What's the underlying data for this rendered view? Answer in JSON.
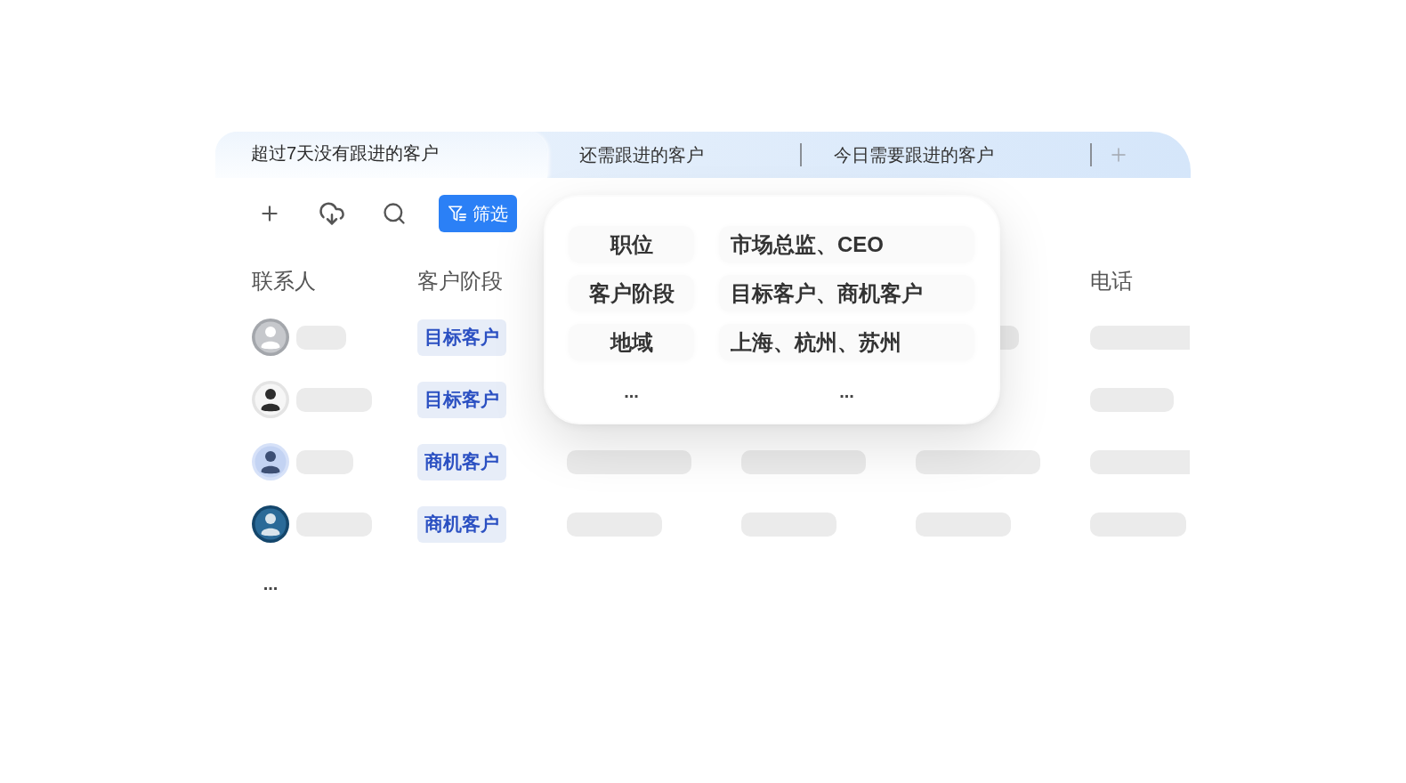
{
  "tabs": [
    {
      "label": "超过7天没有跟进的客户",
      "selected": true
    },
    {
      "label": "还需跟进的客户",
      "selected": false
    },
    {
      "label": "今日需要跟进的客户",
      "selected": false
    }
  ],
  "toolbar": {
    "filter_button": {
      "label": "筛选",
      "active": true
    }
  },
  "table": {
    "columns": [
      {
        "label": "联系人"
      },
      {
        "label": "客户阶段"
      },
      {
        "label": "电话"
      }
    ],
    "rows": [
      {
        "stage": "目标客户"
      },
      {
        "stage": "目标客户"
      },
      {
        "stage": "商机客户"
      },
      {
        "stage": "商机客户"
      }
    ],
    "more": "..."
  },
  "filter_popup": {
    "conditions": [
      {
        "field": "职位",
        "value": "市场总监、CEO"
      },
      {
        "field": "客户阶段",
        "value": "目标客户、商机客户"
      },
      {
        "field": "地域",
        "value": "上海、杭州、苏州"
      }
    ],
    "more_field": "...",
    "more_value": "..."
  }
}
